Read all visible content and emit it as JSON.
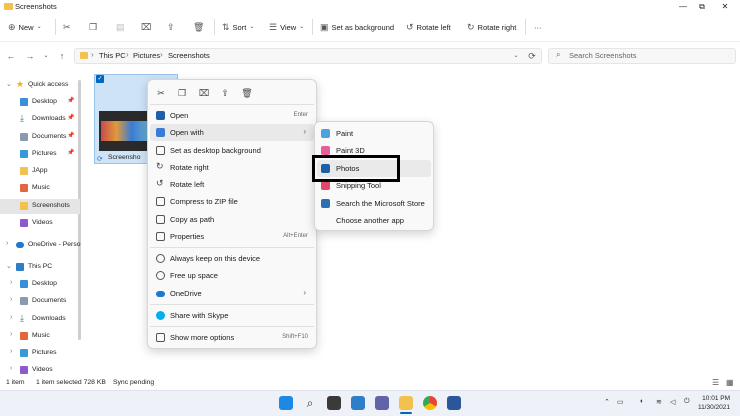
{
  "window": {
    "title": "Screenshots",
    "minimize": "—",
    "maximize": "⧉",
    "close": "✕"
  },
  "toolbar": {
    "new_label": "New",
    "sort_label": "Sort",
    "view_label": "View",
    "set_background_label": "Set as background",
    "rotate_left_label": "Rotate left",
    "rotate_right_label": "Rotate right",
    "more_label": "···"
  },
  "address": {
    "crumbs": [
      "This PC",
      "Pictures",
      "Screenshots"
    ],
    "search_placeholder": "Search Screenshots"
  },
  "sidebar": {
    "items": [
      {
        "label": "Quick access"
      },
      {
        "label": "Desktop"
      },
      {
        "label": "Downloads"
      },
      {
        "label": "Documents"
      },
      {
        "label": "Pictures"
      },
      {
        "label": "JApp"
      },
      {
        "label": "Music"
      },
      {
        "label": "Screenshots"
      },
      {
        "label": "Videos"
      },
      {
        "label": "OneDrive - Perso"
      },
      {
        "label": "This PC"
      },
      {
        "label": "Desktop"
      },
      {
        "label": "Documents"
      },
      {
        "label": "Downloads"
      },
      {
        "label": "Music"
      },
      {
        "label": "Pictures"
      },
      {
        "label": "Videos"
      }
    ]
  },
  "file": {
    "label": "Screensho"
  },
  "context_menu": {
    "items": [
      {
        "label": "Open",
        "shortcut": "Enter"
      },
      {
        "label": "Open with"
      },
      {
        "label": "Set as desktop background"
      },
      {
        "label": "Rotate right"
      },
      {
        "label": "Rotate left"
      },
      {
        "label": "Compress to ZIP file"
      },
      {
        "label": "Copy as path"
      },
      {
        "label": "Properties",
        "shortcut": "Alt+Enter"
      },
      {
        "label": "Always keep on this device"
      },
      {
        "label": "Free up space"
      },
      {
        "label": "OneDrive"
      },
      {
        "label": "Share with Skype"
      },
      {
        "label": "Show more options",
        "shortcut": "Shift+F10"
      }
    ]
  },
  "open_with_menu": {
    "items": [
      {
        "label": "Paint"
      },
      {
        "label": "Paint 3D"
      },
      {
        "label": "Photos"
      },
      {
        "label": "Snipping Tool"
      },
      {
        "label": "Search the Microsoft Store"
      },
      {
        "label": "Choose another app"
      }
    ]
  },
  "status": {
    "count": "1 item",
    "selected": "1 item selected  728 KB",
    "sync": "Sync pending"
  },
  "taskbar": {
    "time": "10:01 PM",
    "date": "11/30/2021"
  },
  "colors": {
    "accent": "#0067c0",
    "folder": "#f2c14e",
    "highlight": "#000000"
  }
}
